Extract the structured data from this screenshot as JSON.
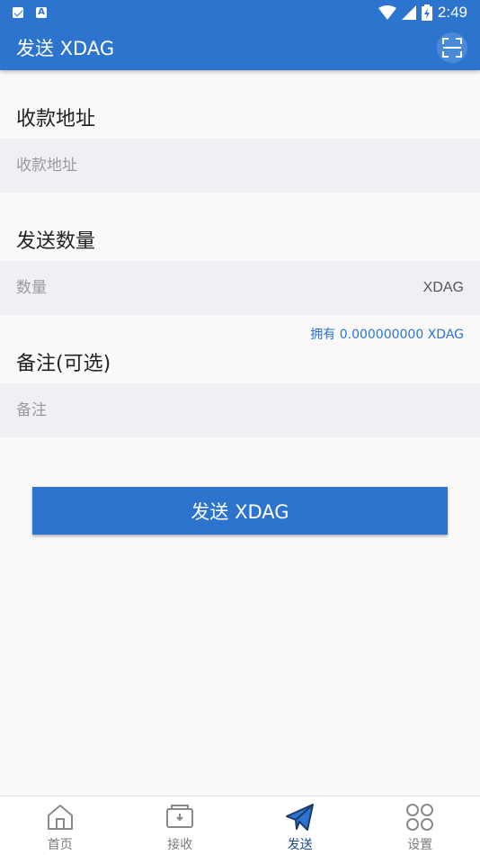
{
  "status_bar": {
    "time": "2:49"
  },
  "app_bar": {
    "title": "发送 XDAG"
  },
  "recipient": {
    "label": "收款地址",
    "placeholder": "收款地址"
  },
  "amount": {
    "label": "发送数量",
    "placeholder": "数量",
    "unit": "XDAG",
    "balance": "拥有 0.000000000 XDAG"
  },
  "memo": {
    "label": "备注(可选)",
    "placeholder": "备注"
  },
  "send_button": {
    "label": "发送 XDAG"
  },
  "bottom_nav": {
    "items": [
      {
        "label": "首页",
        "icon": "home-icon"
      },
      {
        "label": "接收",
        "icon": "wallet-receive-icon"
      },
      {
        "label": "发送",
        "icon": "send-plane-icon",
        "active": true
      },
      {
        "label": "设置",
        "icon": "settings-grid-icon"
      }
    ]
  },
  "colors": {
    "primary": "#2d74cf",
    "field_bg": "#efeff4",
    "active_nav": "#1a4a8a"
  }
}
